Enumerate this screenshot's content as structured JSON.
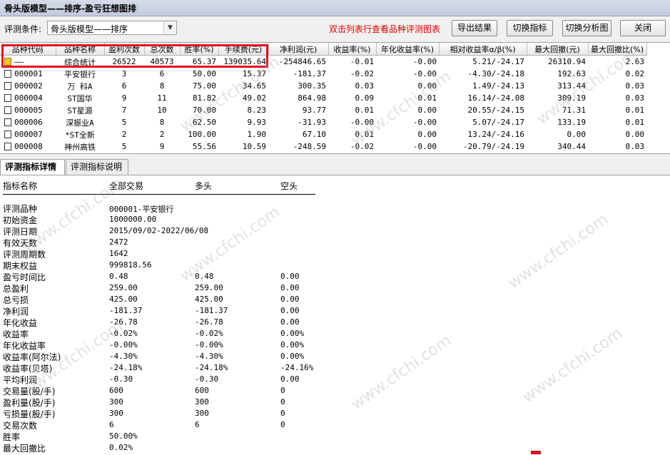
{
  "window": {
    "title": "骨头版模型——排序-盈亏狂想图排"
  },
  "toolbar": {
    "condition_label": "评测条件:",
    "condition_value": "骨头版模型——排序",
    "hint": "双击列表行查看品种评测图表",
    "export_label": "导出结果",
    "switch_indicator_label": "切换指标",
    "switch_analysis_label": "切换分析图",
    "close_label": "关闭"
  },
  "table": {
    "columns": [
      "品种代码",
      "品种名称",
      "盈利次数",
      "总次数",
      "胜率(%)",
      "手续费(元)",
      "净利润(元)",
      "收益率(%)",
      "年化收益率(%)",
      "相对收益率α/β(%)",
      "最大回撤(元)",
      "最大回撤比(%)"
    ],
    "rows": [
      [
        "——",
        "综合统计",
        "26522",
        "40573",
        "65.37",
        "139035.64",
        "-254846.65",
        "-0.01",
        "-0.00",
        "5.21/-24.17",
        "26310.94",
        "2.63"
      ],
      [
        "000001",
        "平安银行",
        "3",
        "6",
        "50.00",
        "15.37",
        "-181.37",
        "-0.02",
        "-0.00",
        "-4.30/-24.18",
        "192.63",
        "0.02"
      ],
      [
        "000002",
        "万 科A",
        "6",
        "8",
        "75.00",
        "34.65",
        "300.35",
        "0.03",
        "0.00",
        "1.49/-24.13",
        "313.44",
        "0.03"
      ],
      [
        "000004",
        "ST国华",
        "9",
        "11",
        "81.82",
        "49.02",
        "864.98",
        "0.09",
        "0.01",
        "16.14/-24.08",
        "309.19",
        "0.03"
      ],
      [
        "000005",
        "ST星源",
        "7",
        "10",
        "70.00",
        "8.23",
        "93.77",
        "0.01",
        "0.00",
        "20.55/-24.15",
        "71.31",
        "0.01"
      ],
      [
        "000006",
        "深振业A",
        "5",
        "8",
        "62.50",
        "9.93",
        "-31.93",
        "-0.00",
        "-0.00",
        "5.07/-24.17",
        "133.19",
        "0.01"
      ],
      [
        "000007",
        "*ST全新",
        "2",
        "2",
        "100.00",
        "1.90",
        "67.10",
        "0.01",
        "0.00",
        "13.24/-24.16",
        "0.00",
        "0.00"
      ],
      [
        "000008",
        "神州高铁",
        "5",
        "9",
        "55.56",
        "10.59",
        "-248.59",
        "-0.02",
        "-0.00",
        "-20.79/-24.19",
        "340.44",
        "0.03"
      ]
    ]
  },
  "tabs": [
    {
      "label": "评测指标详情",
      "active": true
    },
    {
      "label": "评测指标说明",
      "active": false
    }
  ],
  "detail": {
    "headers": [
      "指标名称",
      "全部交易",
      "多头",
      "空头"
    ],
    "rows": [
      [
        "评测品种",
        "000001-平安银行",
        "",
        ""
      ],
      [
        "初始资金",
        "1000000.00",
        "",
        ""
      ],
      [
        "评测日期",
        "2015/09/02-2022/06/08",
        "",
        ""
      ],
      [
        "有效天数",
        "2472",
        "",
        ""
      ],
      [
        "评测周期数",
        "1642",
        "",
        ""
      ],
      [
        "期末权益",
        "999818.56",
        "",
        ""
      ],
      [
        "盈亏时间比",
        "0.48",
        "0.48",
        "0.00"
      ],
      [
        "总盈利",
        "259.00",
        "259.00",
        "0.00"
      ],
      [
        "总亏损",
        "425.00",
        "425.00",
        "0.00"
      ],
      [
        "净利润",
        "-181.37",
        "-181.37",
        "0.00"
      ],
      [
        "年化收益",
        "-26.78",
        "-26.78",
        "0.00"
      ],
      [
        "收益率",
        "-0.02%",
        "-0.02%",
        "0.00%"
      ],
      [
        "年化收益率",
        "-0.00%",
        "-0.00%",
        "0.00%"
      ],
      [
        "收益率(阿尔法)",
        "-4.30%",
        "-4.30%",
        "0.00%"
      ],
      [
        "收益率(贝塔)",
        "-24.18%",
        "-24.18%",
        "-24.16%"
      ],
      [
        "平均利润",
        "-0.30",
        "-0.30",
        "0.00"
      ],
      [
        "交易量(股/手)",
        "600",
        "600",
        "0"
      ],
      [
        "盈利量(股/手)",
        "300",
        "300",
        "0"
      ],
      [
        "亏损量(股/手)",
        "300",
        "300",
        "0"
      ],
      [
        "交易次数",
        "6",
        "6",
        "0"
      ],
      [
        "胜率",
        "50.00%",
        "",
        ""
      ],
      [
        "最大回撤比",
        "0.02%",
        "",
        ""
      ]
    ]
  },
  "watermark": "www.cfchi.com",
  "colors": {
    "highlight": "#e0141e",
    "hint": "#e00000"
  }
}
